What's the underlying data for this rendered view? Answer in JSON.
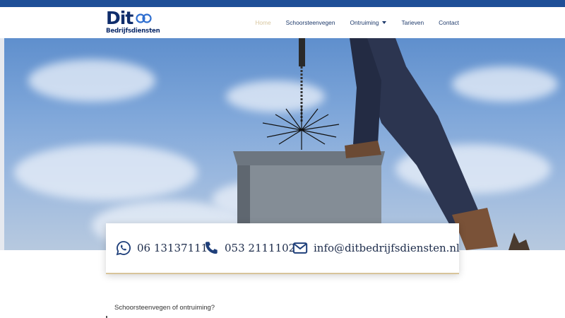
{
  "header": {
    "logo": {
      "brand": "Dit",
      "subtitle": "Bedrijfsdiensten"
    },
    "nav": [
      {
        "label": "Home",
        "active": true
      },
      {
        "label": "Schoorsteenvegen",
        "active": false
      },
      {
        "label": "Ontruiming",
        "active": false,
        "dropdown": true
      },
      {
        "label": "Tarieven",
        "active": false
      },
      {
        "label": "Contact",
        "active": false
      }
    ]
  },
  "hero": {
    "scene": "chimney-sweep-brush-on-chimney-under-blue-sky"
  },
  "contact": {
    "whatsapp": {
      "icon": "whatsapp-icon",
      "label": "06 13137111"
    },
    "phone": {
      "icon": "phone-icon",
      "label": "053 2111102"
    },
    "email": {
      "icon": "envelope-icon",
      "label": "info@ditbedrijfsdiensten.nl"
    }
  },
  "main": {
    "intro": "Schoorsteenvegen of ontruiming?"
  },
  "colors": {
    "topbar": "#1e4f97",
    "brand_navy": "#0f2d6b",
    "nav_active": "#d8c7a0",
    "card_accent": "#d8c49a"
  }
}
